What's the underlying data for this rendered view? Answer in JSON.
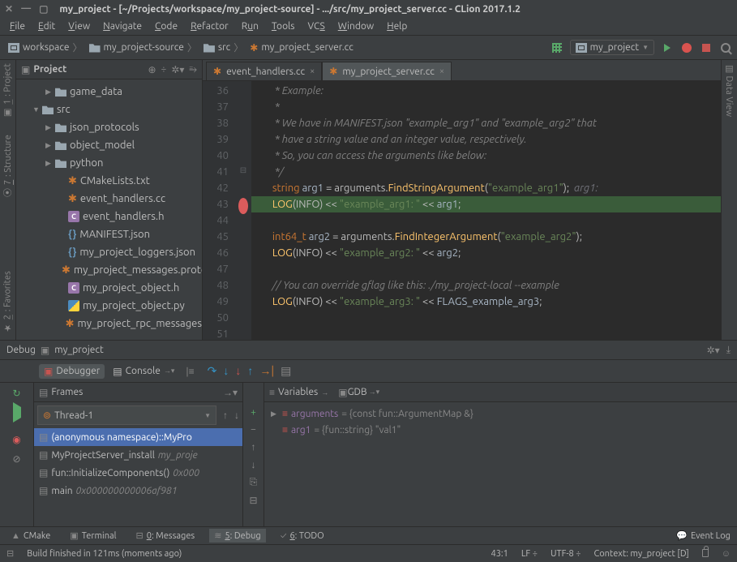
{
  "title": "my_project - [~/Projects/workspace/my_project-source] - .../src/my_project_server.cc - CLion 2017.1.2",
  "menu": [
    "File",
    "Edit",
    "View",
    "Navigate",
    "Code",
    "Refactor",
    "Run",
    "Tools",
    "VCS",
    "Window",
    "Help"
  ],
  "breadcrumbs": [
    {
      "label": "workspace",
      "type": "module"
    },
    {
      "label": "my_project-source",
      "type": "folder"
    },
    {
      "label": "src",
      "type": "folder"
    },
    {
      "label": "my_project_server.cc",
      "type": "file"
    }
  ],
  "run_config": "my_project",
  "left_tabs": [
    "1: Project",
    "7: Structure",
    "2: Favorites"
  ],
  "right_tabs": [
    "Data View"
  ],
  "project_panel_title": "Project",
  "tree": [
    {
      "label": "game_data",
      "depth": 2,
      "icon": "folder",
      "arrow": "▶"
    },
    {
      "label": "src",
      "depth": 1,
      "icon": "folder",
      "arrow": "▼"
    },
    {
      "label": "json_protocols",
      "depth": 2,
      "icon": "folder",
      "arrow": "▶"
    },
    {
      "label": "object_model",
      "depth": 2,
      "icon": "folder",
      "arrow": "▶"
    },
    {
      "label": "python",
      "depth": 2,
      "icon": "folder",
      "arrow": "▶"
    },
    {
      "label": "CMakeLists.txt",
      "depth": 3,
      "icon": "star"
    },
    {
      "label": "event_handlers.cc",
      "depth": 3,
      "icon": "star"
    },
    {
      "label": "event_handlers.h",
      "depth": 3,
      "icon": "c"
    },
    {
      "label": "MANIFEST.json",
      "depth": 3,
      "icon": "curly"
    },
    {
      "label": "my_project_loggers.json",
      "depth": 3,
      "icon": "curly"
    },
    {
      "label": "my_project_messages.proto",
      "depth": 3,
      "icon": "star"
    },
    {
      "label": "my_project_object.h",
      "depth": 3,
      "icon": "c"
    },
    {
      "label": "my_project_object.py",
      "depth": 3,
      "icon": "py"
    },
    {
      "label": "my_project_rpc_messages",
      "depth": 3,
      "icon": "star"
    }
  ],
  "editor_tabs": [
    {
      "label": "event_handlers.cc",
      "active": false
    },
    {
      "label": "my_project_server.cc",
      "active": true
    }
  ],
  "line_start": 36,
  "line_count": 16,
  "breakpoint_line": 43,
  "debug": {
    "title": "Debug",
    "config": "my_project",
    "tabs": [
      "Debugger",
      "Console"
    ],
    "frames_title": "Frames",
    "vars_title": "Variables",
    "gdb_title": "GDB",
    "thread": "Thread-1",
    "frames": [
      {
        "label": "(anonymous namespace)::MyPro",
        "selected": true
      },
      {
        "label": "MyProjectServer_install",
        "dim": "my_proje"
      },
      {
        "label": "fun::InitializeComponents()",
        "dim": "0x000"
      },
      {
        "label": "main",
        "dim": "0x000000000006af981"
      }
    ],
    "vars": [
      {
        "arrow": "▶",
        "name": "arguments",
        "value": "= {const fun::ArgumentMap &}"
      },
      {
        "arrow": "",
        "name": "arg1",
        "value": "= {fun::string} \"val1\""
      }
    ]
  },
  "bottom_tabs": [
    {
      "icon": "▲",
      "label": "CMake"
    },
    {
      "icon": "▣",
      "label": "Terminal"
    },
    {
      "icon": "⊟",
      "label": "0: Messages",
      "u": "0"
    },
    {
      "icon": "≋",
      "label": "5: Debug",
      "u": "5",
      "active": true
    },
    {
      "icon": "✓",
      "label": "6: TODO",
      "u": "6"
    }
  ],
  "event_log": "Event Log",
  "status_msg": "Build finished in 121ms (moments ago)",
  "status_right": [
    "43:1",
    "LF ÷",
    "UTF-8 ÷",
    "Context: my_project [D]"
  ]
}
